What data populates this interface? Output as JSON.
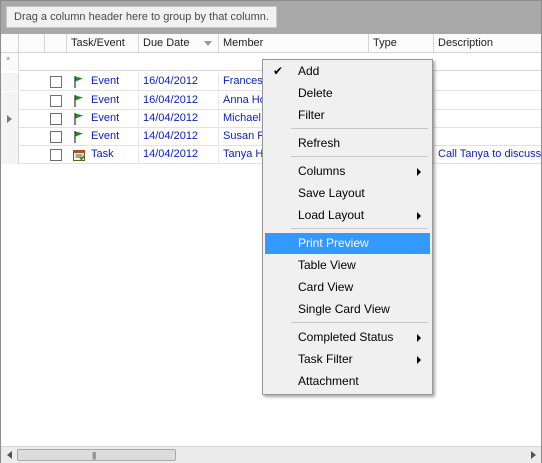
{
  "group_panel": {
    "hint": "Drag a column header here to group by that column."
  },
  "columns": [
    "Task/Event",
    "Due Date",
    "Member",
    "Type",
    "Description"
  ],
  "new_row_marker": "*",
  "rows": [
    {
      "type": "Event",
      "date": "16/04/2012",
      "member": "Frances",
      "icon": "flag-icon",
      "description": ""
    },
    {
      "type": "Event",
      "date": "16/04/2012",
      "member": "Anna Ho",
      "icon": "flag-icon",
      "description": ""
    },
    {
      "type": "Event",
      "date": "14/04/2012",
      "member": "Michael",
      "icon": "flag-icon",
      "description": "",
      "current": true
    },
    {
      "type": "Event",
      "date": "14/04/2012",
      "member": "Susan Fe",
      "icon": "flag-icon",
      "description": ""
    },
    {
      "type": "Task",
      "date": "14/04/2012",
      "member": "Tanya H",
      "icon": "task-icon",
      "description": "Call Tanya to discuss"
    }
  ],
  "context_menu": {
    "items": [
      {
        "label": "Add",
        "checked": true
      },
      {
        "label": "Delete"
      },
      {
        "label": "Filter"
      },
      {
        "label": "Refresh"
      },
      {
        "label": "Columns",
        "submenu": true
      },
      {
        "label": "Save Layout"
      },
      {
        "label": "Load Layout",
        "submenu": true
      },
      {
        "label": "Print Preview",
        "highlighted": true
      },
      {
        "label": "Table View"
      },
      {
        "label": "Card View"
      },
      {
        "label": "Single Card View"
      },
      {
        "label": "Completed Status",
        "submenu": true
      },
      {
        "label": "Task Filter",
        "submenu": true
      },
      {
        "label": "Attachment"
      }
    ]
  },
  "colors": {
    "link_text": "#0a1dbb",
    "menu_highlight": "#3399ff",
    "group_panel": "#a8a8a8"
  }
}
